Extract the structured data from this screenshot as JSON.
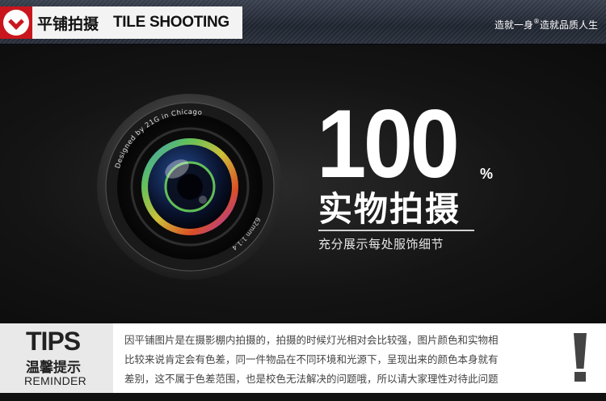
{
  "header": {
    "title": "平铺拍摄",
    "subtitle": "TILE SHOOTING",
    "slogan_prefix": "造就一身",
    "slogan_mark": "®",
    "slogan_suffix": "造就品质人生"
  },
  "hero": {
    "lens_text_top": "Designed by 21G in Chicago",
    "lens_text_bottom": "62mm 1:1.4",
    "number": "100",
    "percent": "%",
    "headline": "实物拍摄",
    "caption": "充分展示每处服饰细节"
  },
  "tips": {
    "title": "TIPS",
    "title_cn": "温馨提示",
    "title_en": "REMINDER",
    "lines": [
      "因平铺图片是在摄影棚内拍摄的，拍摄的时候灯光相对会比较强，图片颜色和实物相",
      "比较来说肯定会有色差，同一件物品在不同环境和光源下，呈现出来的颜色本身就有",
      "差别，这不属于色差范围，也是校色无法解决的问题哦，所以请大家理性对待此问题"
    ]
  },
  "colors": {
    "brand_red": "#c9161d",
    "background_dark": "#111111",
    "tips_panel": "#e9e9e9"
  }
}
